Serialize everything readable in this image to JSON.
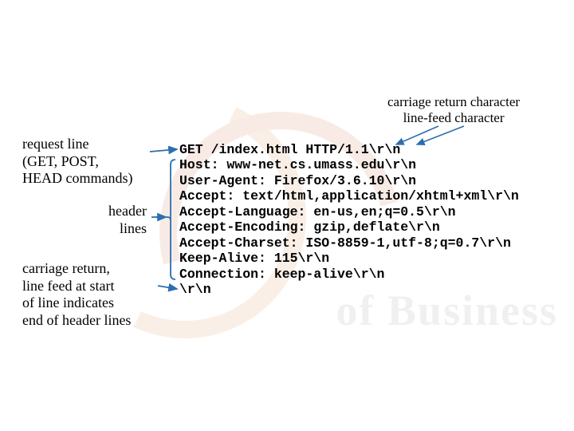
{
  "labels": {
    "request_line": "request line\n(GET, POST,\nHEAD commands)",
    "header_lines": "header\nlines",
    "carriage_return": "carriage return,\nline feed at start\nof line indicates\nend of header lines",
    "cr_char": "carriage return character",
    "lf_char": "line-feed character"
  },
  "code": {
    "lines": [
      "GET /index.html HTTP/1.1\\r\\n",
      "Host: www-net.cs.umass.edu\\r\\n",
      "User-Agent: Firefox/3.6.10\\r\\n",
      "Accept: text/html,application/xhtml+xml\\r\\n",
      "Accept-Language: en-us,en;q=0.5\\r\\n",
      "Accept-Encoding: gzip,deflate\\r\\n",
      "Accept-Charset: ISO-8859-1,utf-8;q=0.7\\r\\n",
      "Keep-Alive: 115\\r\\n",
      "Connection: keep-alive\\r\\n",
      "\\r\\n"
    ]
  },
  "watermark": {
    "text": "of Business"
  }
}
